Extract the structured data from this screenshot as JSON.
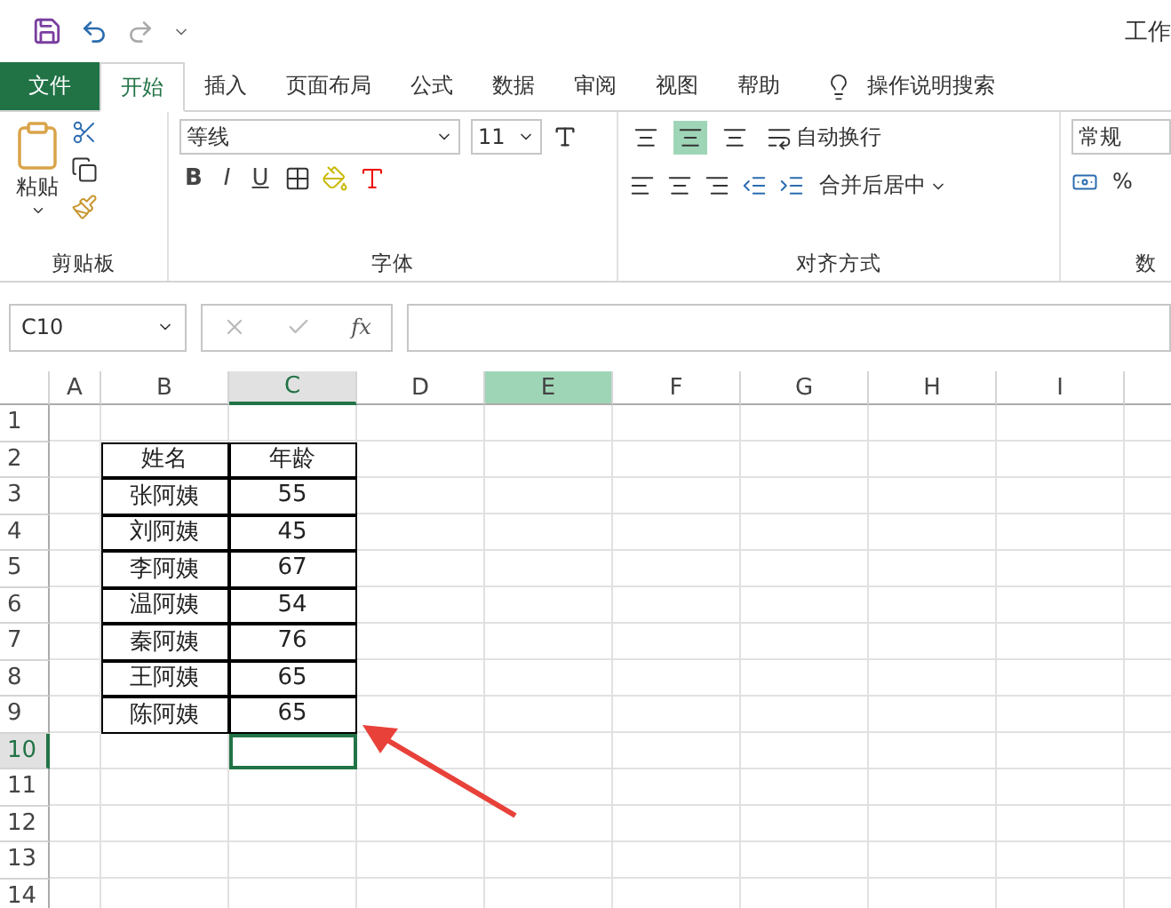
{
  "title_bar": {
    "title": "工作"
  },
  "tabs": [
    {
      "label": "文件",
      "kind": "file",
      "selected": false
    },
    {
      "label": "开始",
      "kind": "tab",
      "selected": true
    },
    {
      "label": "插入",
      "kind": "tab",
      "selected": false
    },
    {
      "label": "页面布局",
      "kind": "tab",
      "selected": false
    },
    {
      "label": "公式",
      "kind": "tab",
      "selected": false
    },
    {
      "label": "数据",
      "kind": "tab",
      "selected": false
    },
    {
      "label": "审阅",
      "kind": "tab",
      "selected": false
    },
    {
      "label": "视图",
      "kind": "tab",
      "selected": false
    },
    {
      "label": "帮助",
      "kind": "tab",
      "selected": false
    }
  ],
  "tell_me": {
    "label": "操作说明搜索"
  },
  "ribbon": {
    "clipboard": {
      "paste": "粘贴",
      "group": "剪贴板"
    },
    "font": {
      "name": "等线",
      "size": "11",
      "bold": "B",
      "italic": "I",
      "underline": "U",
      "group": "字体"
    },
    "alignment": {
      "middle_align_on": true,
      "wrap": "自动换行",
      "merge": "合并后居中",
      "group": "对齐方式"
    },
    "number": {
      "format": "常规",
      "percent": "%",
      "group": "数"
    }
  },
  "formula_bar": {
    "name_box": "C10",
    "fx": "fx"
  },
  "sheet": {
    "columns": [
      {
        "label": "A",
        "selected": false,
        "highlighted": false
      },
      {
        "label": "B",
        "selected": false,
        "highlighted": false
      },
      {
        "label": "C",
        "selected": true,
        "highlighted": false
      },
      {
        "label": "D",
        "selected": false,
        "highlighted": false
      },
      {
        "label": "E",
        "selected": false,
        "highlighted": true
      },
      {
        "label": "F",
        "selected": false,
        "highlighted": false
      },
      {
        "label": "G",
        "selected": false,
        "highlighted": false
      },
      {
        "label": "H",
        "selected": false,
        "highlighted": false
      },
      {
        "label": "I",
        "selected": false,
        "highlighted": false
      }
    ],
    "rows": [
      {
        "label": "1",
        "selected": false
      },
      {
        "label": "2",
        "selected": false,
        "cells": {
          "B": "姓名",
          "C": "年龄"
        }
      },
      {
        "label": "3",
        "selected": false,
        "cells": {
          "B": "张阿姨",
          "C": "55"
        }
      },
      {
        "label": "4",
        "selected": false,
        "cells": {
          "B": "刘阿姨",
          "C": "45"
        }
      },
      {
        "label": "5",
        "selected": false,
        "cells": {
          "B": "李阿姨",
          "C": "67"
        }
      },
      {
        "label": "6",
        "selected": false,
        "cells": {
          "B": "温阿姨",
          "C": "54"
        }
      },
      {
        "label": "7",
        "selected": false,
        "cells": {
          "B": "秦阿姨",
          "C": "76"
        }
      },
      {
        "label": "8",
        "selected": false,
        "cells": {
          "B": "王阿姨",
          "C": "65"
        }
      },
      {
        "label": "9",
        "selected": false,
        "cells": {
          "B": "陈阿姨",
          "C": "65"
        }
      },
      {
        "label": "10",
        "selected": true
      },
      {
        "label": "11",
        "selected": false
      },
      {
        "label": "12",
        "selected": false
      },
      {
        "label": "13",
        "selected": false
      },
      {
        "label": "14",
        "selected": false
      }
    ]
  }
}
